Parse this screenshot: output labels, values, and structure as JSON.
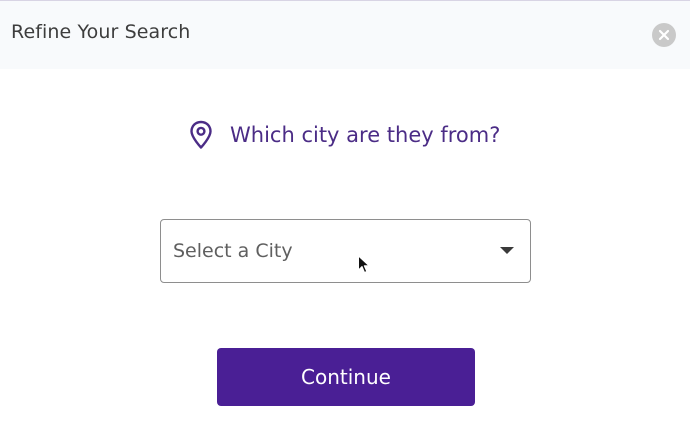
{
  "dialog": {
    "title": "Refine Your Search",
    "close_icon": "close-icon"
  },
  "question": {
    "icon": "location-pin-icon",
    "text": "Which city are they from?"
  },
  "city_select": {
    "placeholder": "Select a City",
    "dropdown_icon": "chevron-down-icon"
  },
  "actions": {
    "continue_label": "Continue"
  },
  "colors": {
    "brand_purple": "#4a1f95",
    "question_text": "#4b2c86",
    "header_bg": "#f8fafc",
    "close_bg": "#c9c9c9"
  }
}
